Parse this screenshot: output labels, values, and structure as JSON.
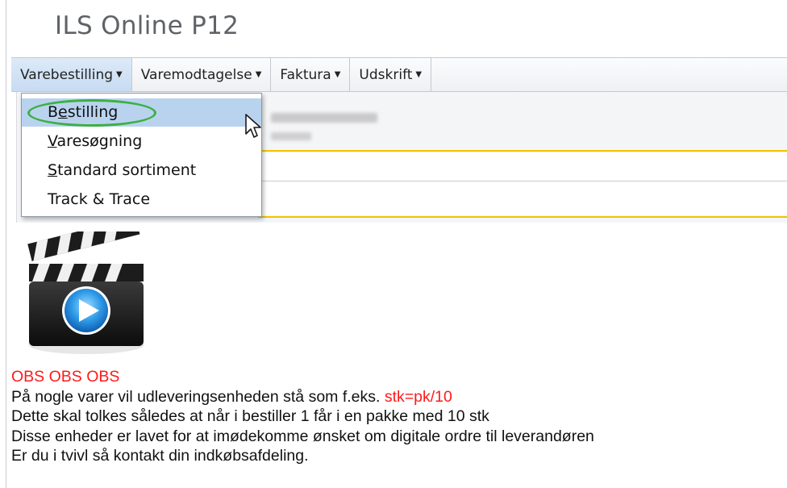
{
  "app": {
    "title": "ILS Online P12"
  },
  "menubar": {
    "items": [
      {
        "label": "Varebestilling"
      },
      {
        "label": "Varemodtagelse"
      },
      {
        "label": "Faktura"
      },
      {
        "label": "Udskrift"
      }
    ]
  },
  "dropdown": {
    "items": [
      {
        "first": "B",
        "underlined": "e",
        "rest": "stilling"
      },
      {
        "first": "",
        "underlined": "V",
        "rest": "aresøgning"
      },
      {
        "first": "",
        "underlined": "S",
        "rest": "tandard sortiment"
      },
      {
        "first": "",
        "underlined": "",
        "rest": "Track & Trace"
      }
    ]
  },
  "notice": {
    "heading": "OBS OBS OBS",
    "line1_prefix": "På nogle varer vil udleveringsenheden stå som f.eks. ",
    "line1_highlight": "stk=pk/10",
    "line2": "Dette skal tolkes således at når i bestiller 1 får i en pakke med 10 stk",
    "line3": "Disse enheder er lavet for at imødekomme ønsket om digitale ordre til leverandøren",
    "line4": "Er du i tvivl så kontakt din indkøbsafdeling."
  },
  "colors": {
    "accent": "#3cb043",
    "highlight": "#b9d3ef",
    "warning": "#ff1a1a",
    "divider": "#f2c300"
  },
  "icons": {
    "video": "clapperboard-play-icon",
    "caret": "caret-down-icon",
    "cursor": "mouse-pointer-icon"
  }
}
